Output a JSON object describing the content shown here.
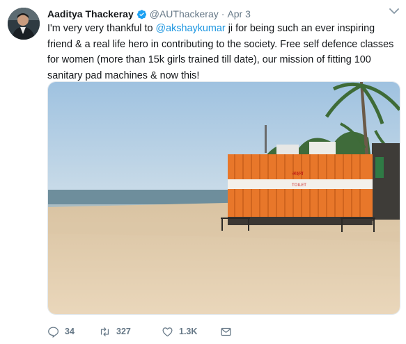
{
  "tweet": {
    "author_name": "Aaditya Thackeray",
    "handle": "@AUThackeray",
    "separator": "·",
    "date": "Apr 3",
    "text_before_mention": "I'm very very thankful to ",
    "mention": "@akshaykumar",
    "text_after_mention": " ji for being such an ever inspiring friend & a real life hero in contributing to the society. Free self defence classes for women (more than 15k girls trained till date), our mission of fitting 100 sanitary pad machines & now this!"
  },
  "media": {
    "description_icon": "photo",
    "container_sign_text": "अक्षय",
    "container_stripe_text": "TOILET"
  },
  "actions": {
    "reply_count": "34",
    "retweet_count": "327",
    "like_count": "1.3K",
    "reply_icon": "reply-icon",
    "retweet_icon": "retweet-icon",
    "like_icon": "heart-icon",
    "dm_icon": "envelope-icon"
  },
  "colors": {
    "link": "#1b95e0",
    "muted": "#657786",
    "verified": "#1da1f2"
  }
}
